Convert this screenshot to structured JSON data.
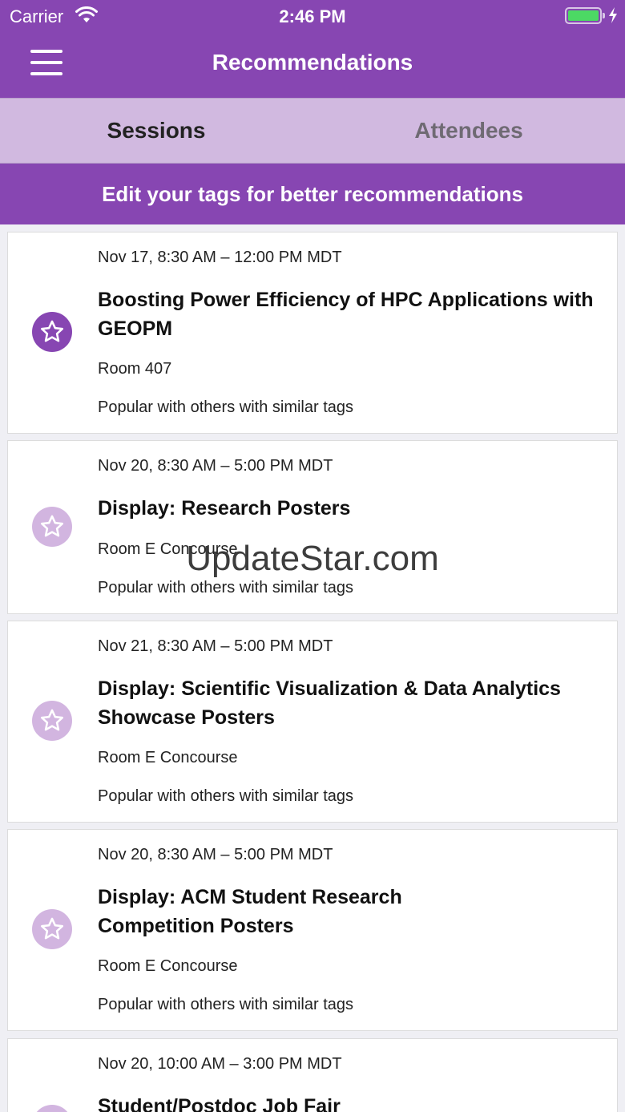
{
  "status_bar": {
    "carrier": "Carrier",
    "time": "2:46 PM",
    "battery_level": 1.0
  },
  "nav": {
    "title": "Recommendations"
  },
  "tabs": [
    {
      "label": "Sessions",
      "selected": true
    },
    {
      "label": "Attendees",
      "selected": false
    }
  ],
  "banner": {
    "text": "Edit your tags for better recommendations"
  },
  "sessions": [
    {
      "date": "Nov 17, 8:30 AM – 12:00 PM MDT",
      "title": "Boosting Power Efficiency of HPC Applications with GEOPM",
      "room": "Room 407",
      "reason": "Popular with others with similar tags",
      "starred": true
    },
    {
      "date": "Nov 20, 8:30 AM – 5:00 PM MDT",
      "title": "Display: Research Posters",
      "room": "Room E Concourse",
      "reason": "Popular with others with similar tags",
      "starred": false
    },
    {
      "date": "Nov 21, 8:30 AM – 5:00 PM MDT",
      "title": "Display: Scientific Visualization & Data Analytics Showcase Posters",
      "room": "Room E Concourse",
      "reason": "Popular with others with similar tags",
      "starred": false
    },
    {
      "date": "Nov 20, 8:30 AM – 5:00 PM MDT",
      "title": "Display: ACM Student Research Competition Posters",
      "room": "Room E Concourse",
      "reason": "Popular with others with similar tags",
      "starred": false
    },
    {
      "date": "Nov 20, 10:00 AM – 3:00 PM MDT",
      "title": "Student/Postdoc Job Fair",
      "starred": false
    }
  ],
  "watermark": "UpdateStar.com",
  "colors": {
    "brand": "#8746b2",
    "tab_bar": "#d1b9e0",
    "star_inactive": "#d2b5e0",
    "battery": "#4cd964"
  }
}
